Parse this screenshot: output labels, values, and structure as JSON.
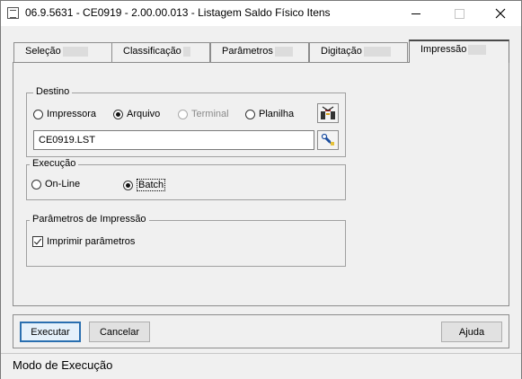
{
  "window": {
    "title": "06.9.5631 - CE0919 - 2.00.00.013 - Listagem Saldo Físico Itens"
  },
  "tabs": [
    {
      "label": "Seleção",
      "active": false
    },
    {
      "label": "Classificação",
      "active": false
    },
    {
      "label": "Parâmetros",
      "active": false
    },
    {
      "label": "Digitação",
      "active": false
    },
    {
      "label": "Impressão",
      "active": true
    }
  ],
  "destino": {
    "label": "Destino",
    "options": [
      {
        "label": "Impressora",
        "checked": false,
        "enabled": true
      },
      {
        "label": "Arquivo",
        "checked": true,
        "enabled": true
      },
      {
        "label": "Terminal",
        "checked": false,
        "enabled": false
      },
      {
        "label": "Planilha",
        "checked": false,
        "enabled": true
      }
    ],
    "file_value": "CE0919.LST",
    "config_icon": "printer-config-icon",
    "browse_icon": "file-browse-icon"
  },
  "execucao": {
    "label": "Execução",
    "options": [
      {
        "label": "On-Line",
        "checked": false
      },
      {
        "label": "Batch",
        "checked": true
      }
    ]
  },
  "parametros_impressao": {
    "label": "Parâmetros de Impressão",
    "imprimir_label": "Imprimir parâmetros",
    "imprimir_checked": true
  },
  "buttons": {
    "executar": "Executar",
    "cancelar": "Cancelar",
    "ajuda": "Ajuda"
  },
  "status": {
    "text": "Modo de Execução"
  },
  "colors": {
    "accent": "#2a6fb0",
    "window_bg": "#f0f0f0"
  }
}
